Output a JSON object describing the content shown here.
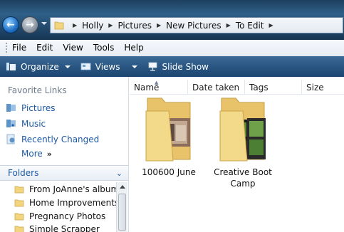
{
  "address": {
    "crumbs": [
      "Holly",
      "Pictures",
      "New Pictures",
      "To Edit"
    ]
  },
  "menu": [
    "File",
    "Edit",
    "View",
    "Tools",
    "Help"
  ],
  "commands": {
    "organize": "Organize",
    "views": "Views",
    "slideshow": "Slide Show"
  },
  "favorites": {
    "header": "Favorite Links",
    "items": [
      "Pictures",
      "Music",
      "Recently Changed"
    ],
    "more": "More"
  },
  "folders": {
    "title": "Folders",
    "items": [
      "From JoAnne's albums",
      "Home Improvements",
      "Pregnancy Photos",
      "Simple Scrapper"
    ]
  },
  "columns": [
    "Name",
    "Date taken",
    "Tags",
    "Size"
  ],
  "files": [
    {
      "name": "100600 June",
      "icon": "photo-folder-icon"
    },
    {
      "name": "Creative Boot Camp",
      "name_line1": "Creative Boot",
      "name_line2": "Camp",
      "icon": "photo-folder-icon"
    }
  ],
  "colors": {
    "link": "#1c5aa6",
    "toolbar": "#2b5884",
    "folder": "#f1d27a"
  }
}
